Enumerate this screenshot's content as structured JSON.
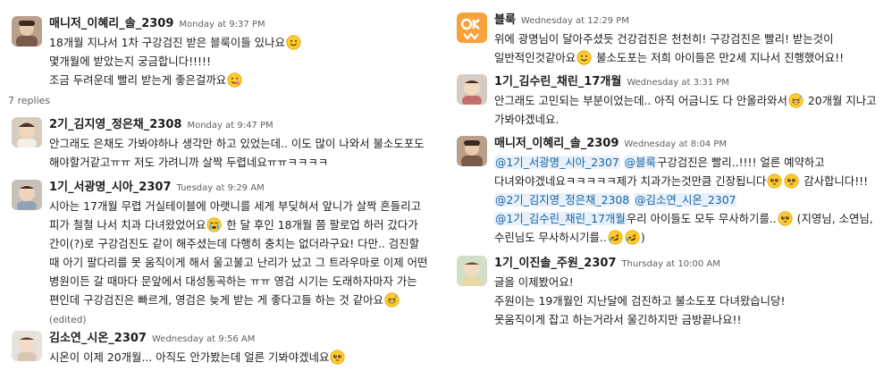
{
  "thread": {
    "replies_label": "7 replies"
  },
  "left_messages": [
    {
      "name": "매니저_이혜리_솔_2309",
      "time": "Monday at 9:37 PM",
      "lines": [
        "18개월 지나서 1차 구강검진 받은 블룩이들 있나요",
        "몇개월에 받았는지 궁금합니다!!!!!",
        "조금 두려운데 빨리 받는게 좋은걸까요"
      ]
    },
    {
      "name": "2기_김지영_정은채_2308",
      "time": "Monday at 9:47 PM",
      "text": "안그래도 은채도 가봐야하나 생각만 하고 있었는데.. 이도 많이 나와서 불소도포도 해야할거같고ㅠㅠ 저도 가려니까 살짝 두렵네요ㅠㅠㅋㅋㅋㅋ"
    },
    {
      "name": "1기_서광명_시아_2307",
      "time": "Tuesday at 9:29 AM",
      "text_a": "시아는 17개월 무렵 거실테이블에 아랫니를 세게 부딪혀서 앞니가 살짝 흔들리고 피가 철철 나서 치과 다녀왔었어요",
      "text_b": " 한 달 후인 18개월 쯤 팔로업 하러 갔다가 간이(?)로 구강검진도 같이 해주셨는데 다행히 충치는 없더라구요! 다만.. 검진할 때 아기 팔다리를 못 움직이게 해서 울고불고 난리가 났고 그 트라우마로 이제 어떤 병원이든 갈 때마다 문앞에서 대성통곡하는 ㅠㅠ 영검 시기는 도래하자마자 가는 편인데 구강검진은 빠르게, 영검은 늦게 받는 게 좋다고들 하는 것 같아요",
      "edited": "(edited)"
    },
    {
      "name": "김소연_시온_2307",
      "time": "Wednesday at 9:56 AM",
      "text": "시온이 이제 20개월... 아직도 안가봤는데 얼른 기봐야겠네요"
    }
  ],
  "right_messages": [
    {
      "name": "블룩",
      "time": "Wednesday at 12:29 PM",
      "text_a": "위에 광명님이 달아주셨듯 건강검진은 천천히! 구강검진은 빨리! 받는것이 일반적인것같아요",
      "text_b": " 불소도포는 저희 아이들은 만2세 지나서 진행했어요!!"
    },
    {
      "name": "1기_김수린_채린_17개월",
      "time": "Wednesday at 3:31 PM",
      "text_a": "안그래도 고민되는 부분이었는데.. 아직 어금니도 다 안올라와서",
      "text_b": " 20개월 지나고 가봐야겠네요."
    },
    {
      "name": "매니저_이혜리_솔_2309",
      "time": "Wednesday at 8:04 PM",
      "mention1": "@1기_서광명_시아_2307",
      "mention2": "@블룩",
      "t1": "구강검진은 빨리..!!!! 얼른 예약하고 다녀와야겠네요ㅋㅋㅋㅋㅋ제가 치과가는것만큼 긴장됩니다",
      "t2": " 감사합니다!!!",
      "mention3": "@2기_김지영_정은채_2308",
      "mention4": "@김소연_시온_2307",
      "mention5": "@1기_김수린_채린_17개월",
      "t3": "우리 아이들도 모두 무사하기를..",
      "t4": " (지영님, 소연님, 수린님도 무사하시기를..",
      "t5": ")"
    },
    {
      "name": "1기_이진솔_주원_2307",
      "time": "Thursday at 10:00 AM",
      "lines": [
        "글을 이제봤어요!",
        "주원이는 19개월인 지난달에 검진하고 불소도포 다녀왔습니당!",
        "못움직이게 잡고 하는거라서 울긴하지만 금방끝나요!!"
      ]
    }
  ],
  "emoji_names": [
    "smiling-face-icon",
    "wink-icon",
    "crying-face-icon",
    "grin-sweat-icon",
    "pleading-face-icon",
    "rofl-icon"
  ]
}
